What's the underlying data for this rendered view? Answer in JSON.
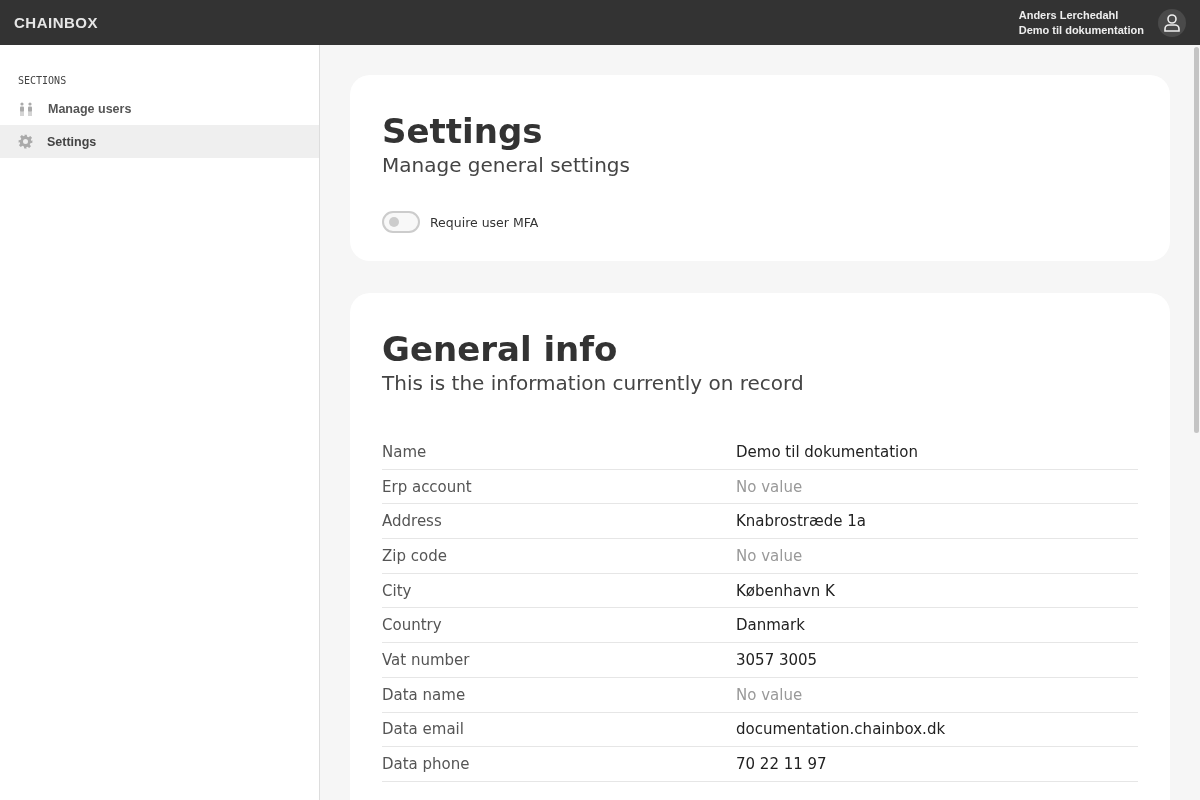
{
  "header": {
    "logo": "CHAINBOX",
    "user_name": "Anders Lerchedahl",
    "organization": "Demo til dokumentation"
  },
  "sidebar": {
    "heading": "SECTIONS",
    "items": [
      {
        "label": "Manage users",
        "kind": "users",
        "selected": false
      },
      {
        "label": "Settings",
        "kind": "gear",
        "selected": true
      }
    ]
  },
  "settings_card": {
    "title": "Settings",
    "subtitle": "Manage general settings",
    "toggle": {
      "label": "Require user MFA",
      "on": false
    }
  },
  "info_card": {
    "title": "General info",
    "subtitle": "This is the information currently on record",
    "rows": [
      {
        "label": "Name",
        "value": "Demo til dokumentation",
        "empty": false
      },
      {
        "label": "Erp account",
        "value": "No value",
        "empty": true
      },
      {
        "label": "Address",
        "value": "Knabrostræde 1a",
        "empty": false
      },
      {
        "label": "Zip code",
        "value": "No value",
        "empty": true
      },
      {
        "label": "City",
        "value": "København K",
        "empty": false
      },
      {
        "label": "Country",
        "value": "Danmark",
        "empty": false
      },
      {
        "label": "Vat number",
        "value": "3057 3005",
        "empty": false
      },
      {
        "label": "Data name",
        "value": "No value",
        "empty": true
      },
      {
        "label": "Data email",
        "value": "documentation.chainbox.dk",
        "empty": false
      },
      {
        "label": "Data phone",
        "value": "70 22 11 97",
        "empty": false
      }
    ]
  }
}
